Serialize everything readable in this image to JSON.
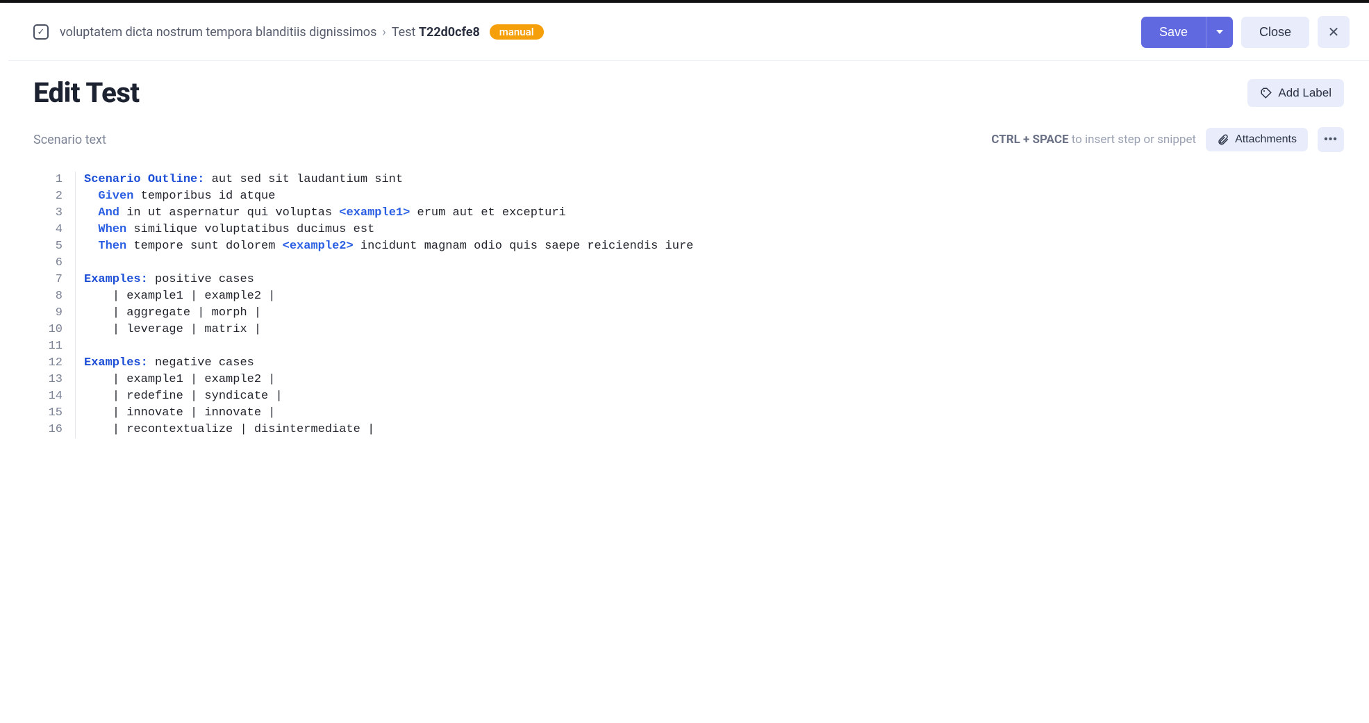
{
  "breadcrumb": {
    "project": "voluptatem dicta nostrum tempora blanditiis dignissimos",
    "test_prefix": "Test",
    "test_code": "T22d0cfe8",
    "badge": "manual"
  },
  "actions": {
    "save": "Save",
    "close": "Close"
  },
  "page": {
    "title": "Edit Test",
    "add_label": "Add Label"
  },
  "toolbar": {
    "scenario_label": "Scenario text",
    "hint_key": "CTRL + SPACE",
    "hint_rest": " to insert step or snippet",
    "attachments": "Attachments"
  },
  "editor": {
    "lines": [
      {
        "n": 1,
        "indent": 0,
        "tokens": [
          {
            "t": "kw-outline",
            "v": "Scenario Outline:"
          },
          {
            "t": "plain",
            "v": " aut sed sit laudantium sint"
          }
        ]
      },
      {
        "n": 2,
        "indent": 1,
        "tokens": [
          {
            "t": "kw-step",
            "v": "Given"
          },
          {
            "t": "plain",
            "v": " temporibus id atque"
          }
        ]
      },
      {
        "n": 3,
        "indent": 1,
        "tokens": [
          {
            "t": "kw-step",
            "v": "And"
          },
          {
            "t": "plain",
            "v": " in ut aspernatur qui voluptas "
          },
          {
            "t": "var",
            "v": "<example1>"
          },
          {
            "t": "plain",
            "v": " erum aut et excepturi"
          }
        ]
      },
      {
        "n": 4,
        "indent": 1,
        "tokens": [
          {
            "t": "kw-step",
            "v": "When"
          },
          {
            "t": "plain",
            "v": " similique voluptatibus ducimus est"
          }
        ]
      },
      {
        "n": 5,
        "indent": 1,
        "tokens": [
          {
            "t": "kw-step",
            "v": "Then"
          },
          {
            "t": "plain",
            "v": " tempore sunt dolorem "
          },
          {
            "t": "var",
            "v": "<example2>"
          },
          {
            "t": "plain",
            "v": " incidunt magnam odio quis saepe reiciendis iure"
          }
        ]
      },
      {
        "n": 6,
        "indent": 0,
        "tokens": []
      },
      {
        "n": 7,
        "indent": 0,
        "tokens": [
          {
            "t": "kw-ex",
            "v": "Examples:"
          },
          {
            "t": "plain",
            "v": " positive cases"
          }
        ]
      },
      {
        "n": 8,
        "indent": 2,
        "tokens": [
          {
            "t": "plain",
            "v": "| example1 | example2 |"
          }
        ]
      },
      {
        "n": 9,
        "indent": 2,
        "tokens": [
          {
            "t": "plain",
            "v": "| aggregate | morph |"
          }
        ]
      },
      {
        "n": 10,
        "indent": 2,
        "tokens": [
          {
            "t": "plain",
            "v": "| leverage | matrix |"
          }
        ]
      },
      {
        "n": 11,
        "indent": 0,
        "tokens": []
      },
      {
        "n": 12,
        "indent": 0,
        "tokens": [
          {
            "t": "kw-ex",
            "v": "Examples:"
          },
          {
            "t": "plain",
            "v": " negative cases"
          }
        ]
      },
      {
        "n": 13,
        "indent": 2,
        "tokens": [
          {
            "t": "plain",
            "v": "| example1 | example2 |"
          }
        ]
      },
      {
        "n": 14,
        "indent": 2,
        "tokens": [
          {
            "t": "plain",
            "v": "| redefine | syndicate |"
          }
        ]
      },
      {
        "n": 15,
        "indent": 2,
        "tokens": [
          {
            "t": "plain",
            "v": "| innovate | innovate |"
          }
        ]
      },
      {
        "n": 16,
        "indent": 2,
        "tokens": [
          {
            "t": "plain",
            "v": "| recontextualize | disintermediate |"
          }
        ]
      }
    ]
  }
}
